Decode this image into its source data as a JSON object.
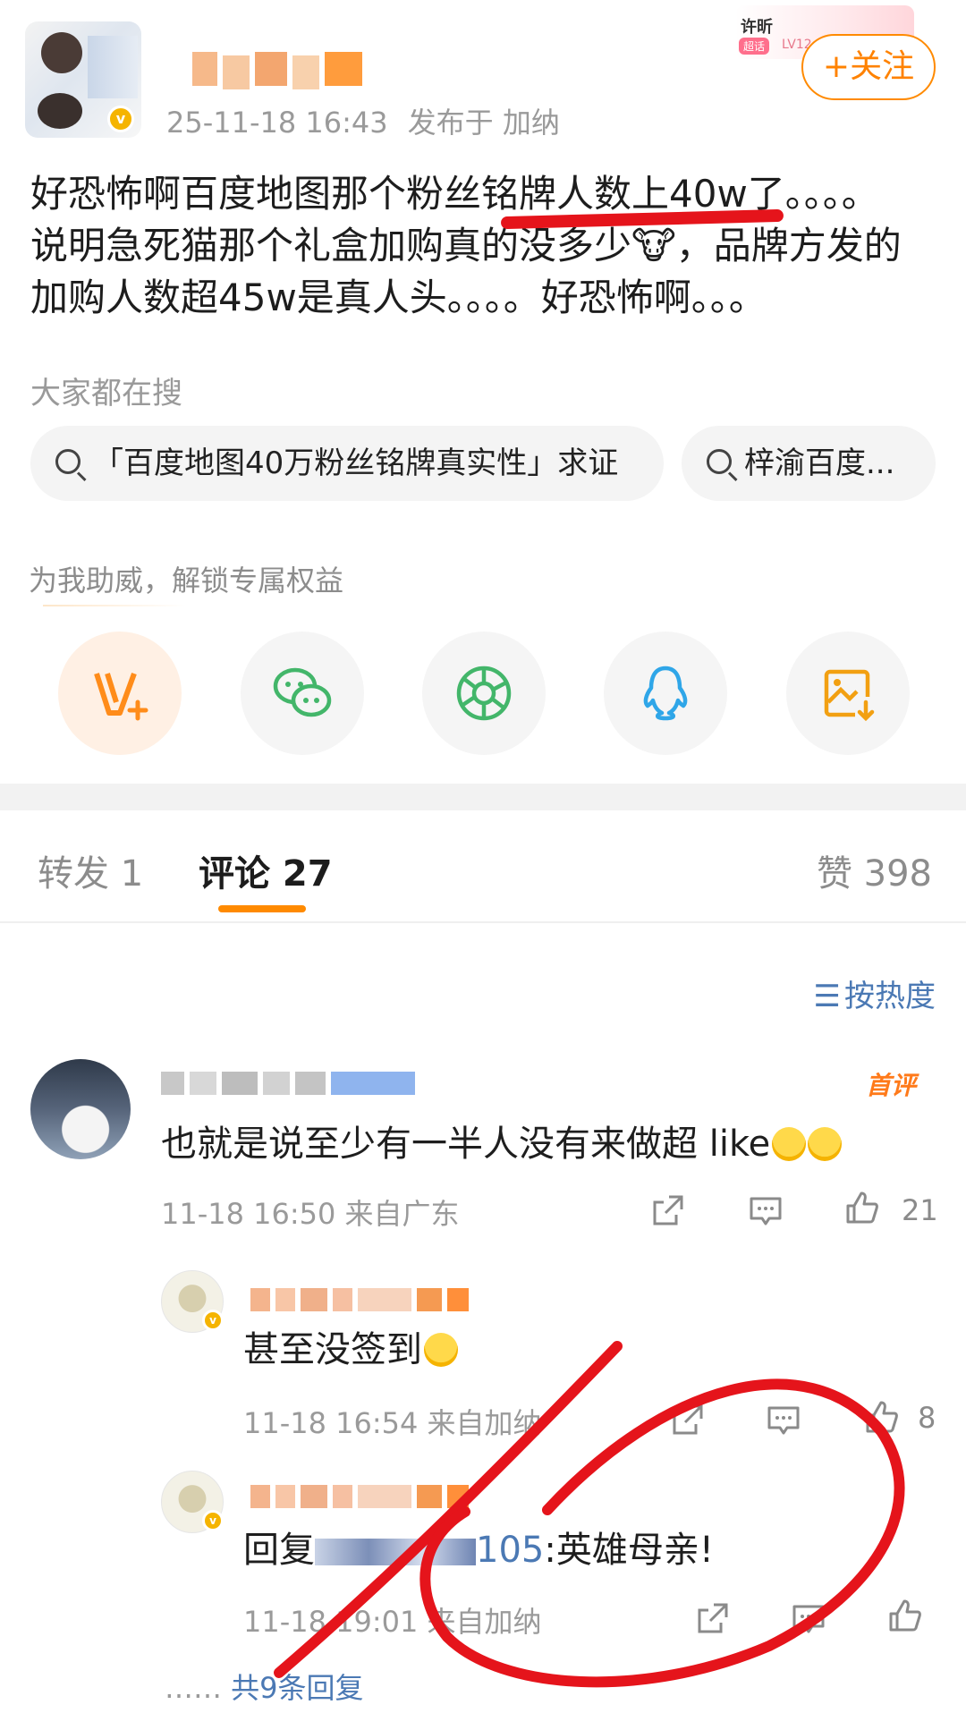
{
  "post": {
    "timestamp": "25-11-18 16:43",
    "location": "发布于 加纳",
    "follow_label": "+关注",
    "badge": {
      "name": "许昕",
      "tag": "超话",
      "level": "LV12"
    },
    "text_lines": [
      "好恐怖啊百度地图那个粉丝铭牌人数上40w了。。。。",
      "说明急死猫那个礼盒加购真的没多少🐮，品牌方发的",
      "加购人数超45w是真人头。。。。好恐怖啊。。。"
    ]
  },
  "search": {
    "title": "大家都在搜",
    "chips": [
      "「百度地图40万粉丝铭牌真实性」求证",
      "梓渝百度..."
    ]
  },
  "boost": {
    "title": "为我助威，解锁专属权益",
    "share_icons": [
      "v-plus-icon",
      "wechat-icon",
      "moments-icon",
      "qq-icon",
      "save-image-icon"
    ]
  },
  "tabs": {
    "repost": "转发 1",
    "comments": "评论 27",
    "likes": "赞 398"
  },
  "sort_label": "按热度",
  "comments": [
    {
      "tag": "首评",
      "text": "也就是说至少有一半人没有来做超 like",
      "meta": "11-18 16:50  来自广东",
      "likes": "21"
    }
  ],
  "replies": [
    {
      "text": "甚至没签到",
      "meta": "11-18 16:54  来自加纳",
      "likes": "8"
    },
    {
      "text_prefix": "回复",
      "mention": "105",
      "text_suffix": ":英雄母亲!",
      "meta": "11-18 19:01  来自加纳",
      "likes": ""
    }
  ],
  "reply_more": "共9条回复",
  "colors": {
    "accent": "#ff8200",
    "link": "#4b79b4",
    "marker": "#e5141b"
  }
}
